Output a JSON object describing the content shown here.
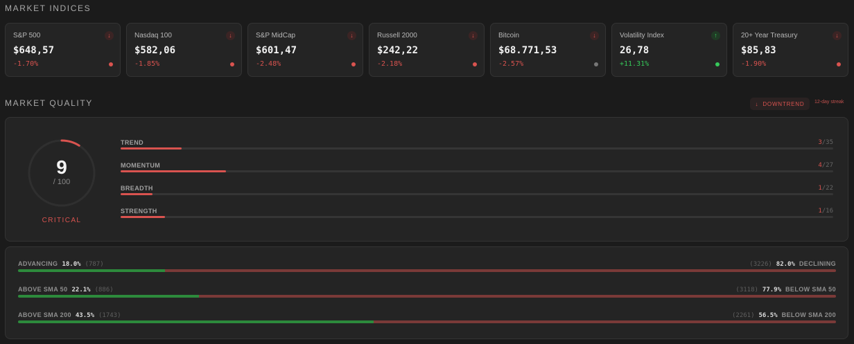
{
  "indices_title": "MARKET INDICES",
  "indices": [
    {
      "name": "S&P 500",
      "price": "$648,57",
      "change": "-1.70%",
      "direction": "down",
      "change_color": "#d9534f",
      "dot_color": "#d9534f"
    },
    {
      "name": "Nasdaq 100",
      "price": "$582,06",
      "change": "-1.85%",
      "direction": "down",
      "change_color": "#d9534f",
      "dot_color": "#d9534f"
    },
    {
      "name": "S&P MidCap",
      "price": "$601,47",
      "change": "-2.48%",
      "direction": "down",
      "change_color": "#d9534f",
      "dot_color": "#d9534f"
    },
    {
      "name": "Russell 2000",
      "price": "$242,22",
      "change": "-2.18%",
      "direction": "down",
      "change_color": "#d9534f",
      "dot_color": "#d9534f"
    },
    {
      "name": "Bitcoin",
      "price": "$68.771,53",
      "change": "-2.57%",
      "direction": "down",
      "change_color": "#d9534f",
      "dot_color": "#777777"
    },
    {
      "name": "Volatility Index",
      "price": "26,78",
      "change": "+11.31%",
      "direction": "up",
      "change_color": "#36c95a",
      "dot_color": "#36c95a"
    },
    {
      "name": "20+ Year Treasury",
      "price": "$85,83",
      "change": "-1.90%",
      "direction": "down",
      "change_color": "#d9534f",
      "dot_color": "#d9534f"
    }
  ],
  "quality_title": "MARKET QUALITY",
  "trend_badge": {
    "icon": "arrow-down-icon",
    "label": "DOWNTREND"
  },
  "streak": "12-day streak",
  "score": {
    "value": "9",
    "max_text": "/ 100",
    "rating": "CRITICAL",
    "fraction": 0.09
  },
  "metrics": [
    {
      "label": "TREND",
      "value": "3",
      "max": "/35",
      "fraction": 0.0857
    },
    {
      "label": "MOMENTUM",
      "value": "4",
      "max": "/27",
      "fraction": 0.148
    },
    {
      "label": "BREADTH",
      "value": "1",
      "max": "/22",
      "fraction": 0.045
    },
    {
      "label": "STRENGTH",
      "value": "1",
      "max": "/16",
      "fraction": 0.0625
    }
  ],
  "breadth": [
    {
      "left_label": "ADVANCING",
      "left_pct": "18.0%",
      "left_count": "(787)",
      "right_count": "(3226)",
      "right_pct": "82.0%",
      "right_label": "DECLINING",
      "fraction": 0.18
    },
    {
      "left_label": "ABOVE  SMA 50",
      "left_pct": "22.1%",
      "left_count": "(886)",
      "right_count": "(3118)",
      "right_pct": "77.9%",
      "right_label": "BELOW  SMA 50",
      "fraction": 0.221
    },
    {
      "left_label": "ABOVE  SMA 200",
      "left_pct": "43.5%",
      "left_count": "(1743)",
      "right_count": "(2261)",
      "right_pct": "56.5%",
      "right_label": "BELOW  SMA 200",
      "fraction": 0.435
    }
  ],
  "colors": {
    "negative": "#d9534f",
    "positive": "#36c95a",
    "breadth_green": "#2d8a3c",
    "breadth_red": "#7a3a38"
  }
}
